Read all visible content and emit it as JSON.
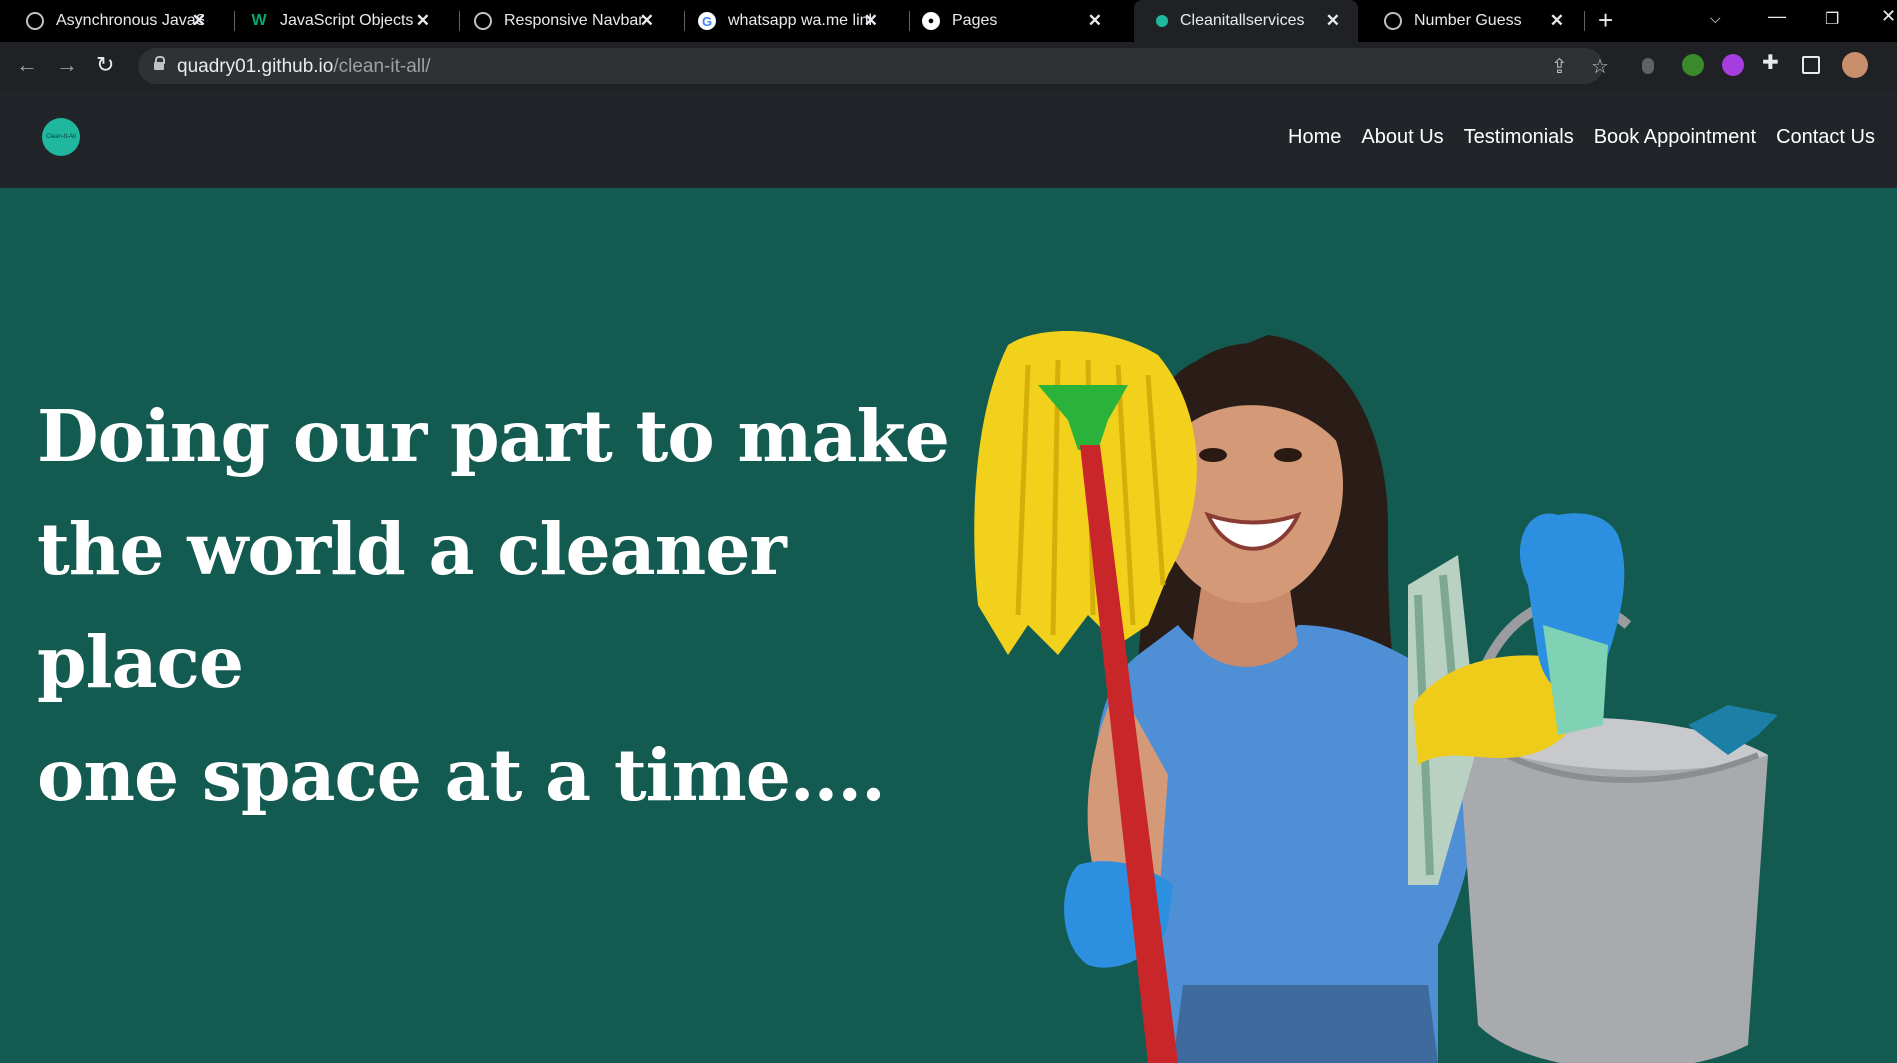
{
  "browser": {
    "tabs": [
      {
        "title": "Asynchronous JavaScr",
        "favicon": "globe-icon"
      },
      {
        "title": "JavaScript Objects",
        "favicon": "w3schools-icon"
      },
      {
        "title": "Responsive Navbar | C",
        "favicon": "globe-icon"
      },
      {
        "title": "whatsapp wa.me links",
        "favicon": "google-icon"
      },
      {
        "title": "Pages",
        "favicon": "github-icon"
      },
      {
        "title": "Cleanitallservices",
        "favicon": "site-icon",
        "active": true
      },
      {
        "title": "Number Guess",
        "favicon": "globe-icon"
      }
    ],
    "url_host": "quadry01.github.io",
    "url_path": "/clean-it-all/"
  },
  "site": {
    "logo_text": "Clean-It-All",
    "nav": [
      "Home",
      "About Us",
      "Testimonials",
      "Book Appointment",
      "Contact Us"
    ],
    "hero_lines": [
      "Doing our part to make",
      "the world a cleaner place",
      "one space at a time...."
    ]
  },
  "colors": {
    "hero_bg": "#135a50",
    "navbar_bg": "#212529",
    "accent": "#1fb89e"
  }
}
